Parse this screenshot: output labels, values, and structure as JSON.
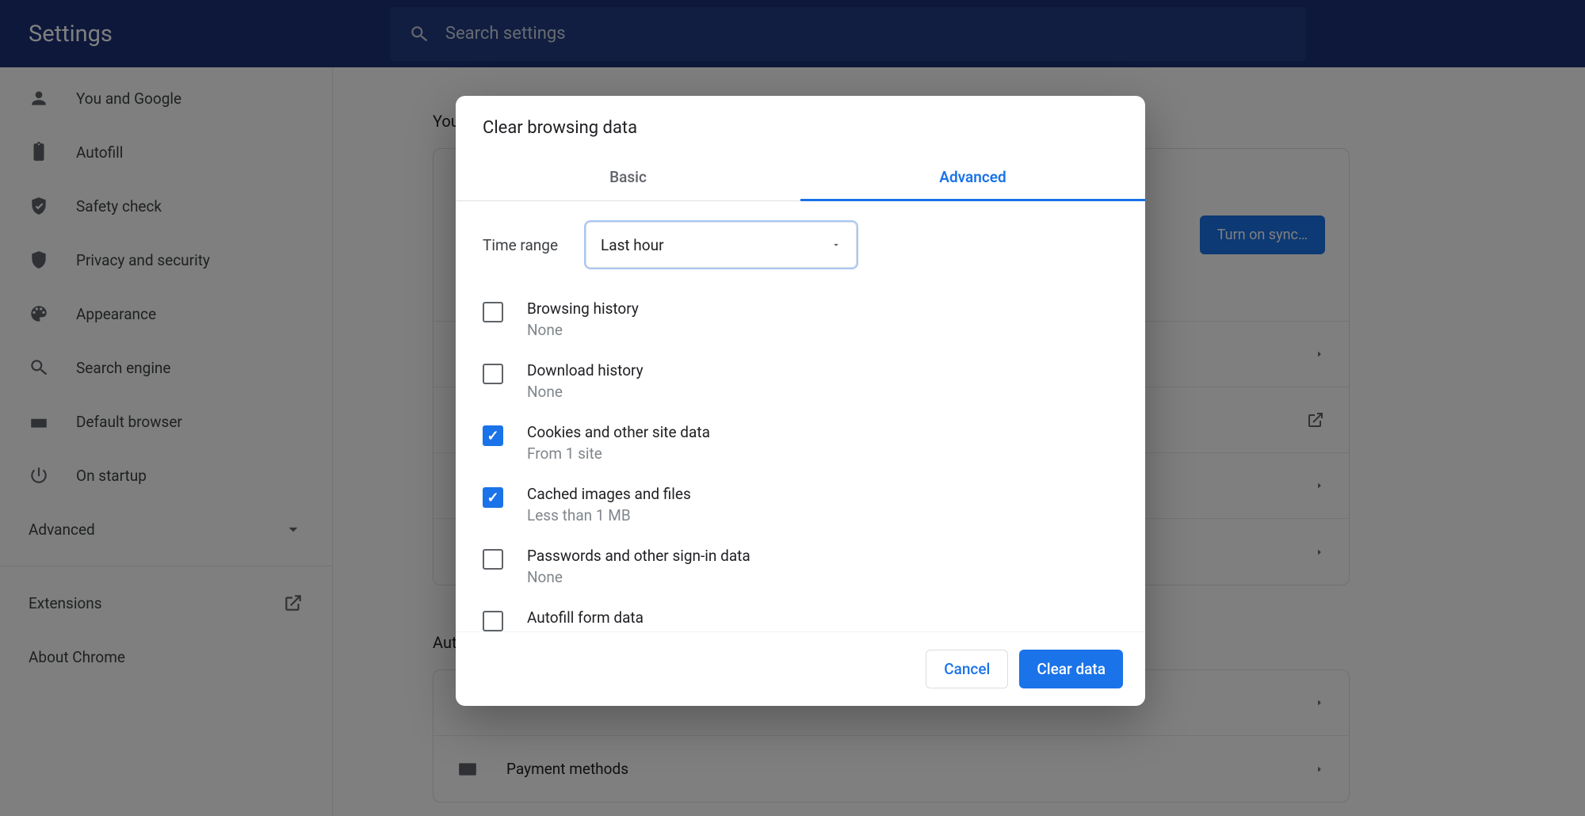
{
  "header": {
    "title": "Settings",
    "search_placeholder": "Search settings"
  },
  "sidebar": {
    "items": [
      {
        "label": "You and Google"
      },
      {
        "label": "Autofill"
      },
      {
        "label": "Safety check"
      },
      {
        "label": "Privacy and security"
      },
      {
        "label": "Appearance"
      },
      {
        "label": "Search engine"
      },
      {
        "label": "Default browser"
      },
      {
        "label": "On startup"
      }
    ],
    "advanced_label": "Advanced",
    "extensions_label": "Extensions",
    "about_label": "About Chrome"
  },
  "main": {
    "section1_heading": "You and Google",
    "sync_button": "Turn on sync…",
    "section2_heading": "Autofill",
    "payment_label": "Payment methods"
  },
  "modal": {
    "title": "Clear browsing data",
    "tabs": {
      "basic": "Basic",
      "advanced": "Advanced"
    },
    "time_label": "Time range",
    "time_value": "Last hour",
    "items": [
      {
        "title": "Browsing history",
        "sub": "None",
        "checked": false
      },
      {
        "title": "Download history",
        "sub": "None",
        "checked": false
      },
      {
        "title": "Cookies and other site data",
        "sub": "From 1 site",
        "checked": true
      },
      {
        "title": "Cached images and files",
        "sub": "Less than 1 MB",
        "checked": true
      },
      {
        "title": "Passwords and other sign-in data",
        "sub": "None",
        "checked": false
      },
      {
        "title": "Autofill form data",
        "sub": "",
        "checked": false
      }
    ],
    "cancel": "Cancel",
    "confirm": "Clear data"
  }
}
